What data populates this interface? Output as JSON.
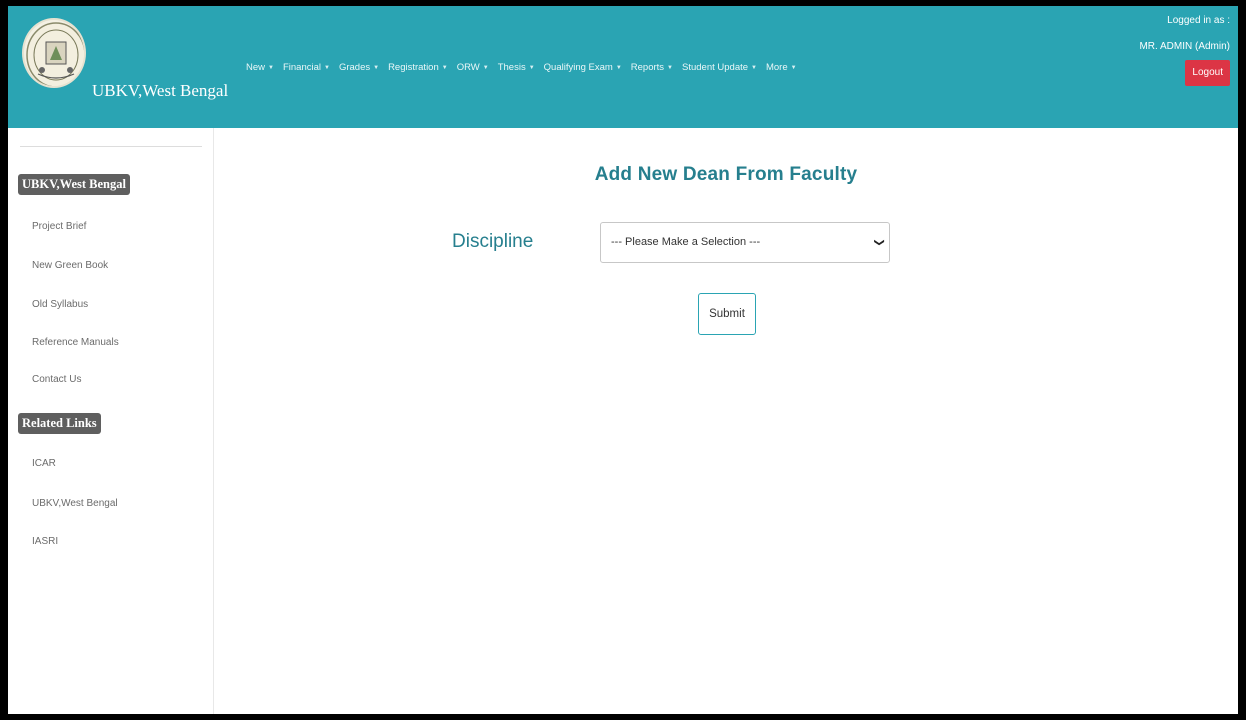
{
  "header": {
    "brand": "UBKV,West Bengal",
    "nav": [
      "New",
      "Financial",
      "Grades",
      "Registration",
      "ORW",
      "Thesis",
      "Qualifying Exam",
      "Reports",
      "Student Update",
      "More"
    ],
    "logged_in_label": "Logged in as :",
    "user_name": "MR. ADMIN (Admin)",
    "logout_label": "Logout"
  },
  "sidebar": {
    "section1_title": "UBKV,West Bengal",
    "section1_links": [
      "Project Brief",
      "New Green Book",
      "Old Syllabus",
      "Reference Manuals",
      "Contact Us"
    ],
    "section2_title": "Related Links",
    "section2_links": [
      "ICAR",
      "UBKV,West Bengal",
      "IASRI"
    ]
  },
  "main": {
    "heading": "Add New Dean From Faculty",
    "discipline_label": "Discipline",
    "discipline_select_value": "--- Please Make a Selection ---",
    "submit_label": "Submit"
  },
  "colors": {
    "header_bg": "#2aa4b3",
    "heading_text": "#267f8e",
    "logout_bg": "#dc3545",
    "badge_bg": "#5f5f5f"
  }
}
